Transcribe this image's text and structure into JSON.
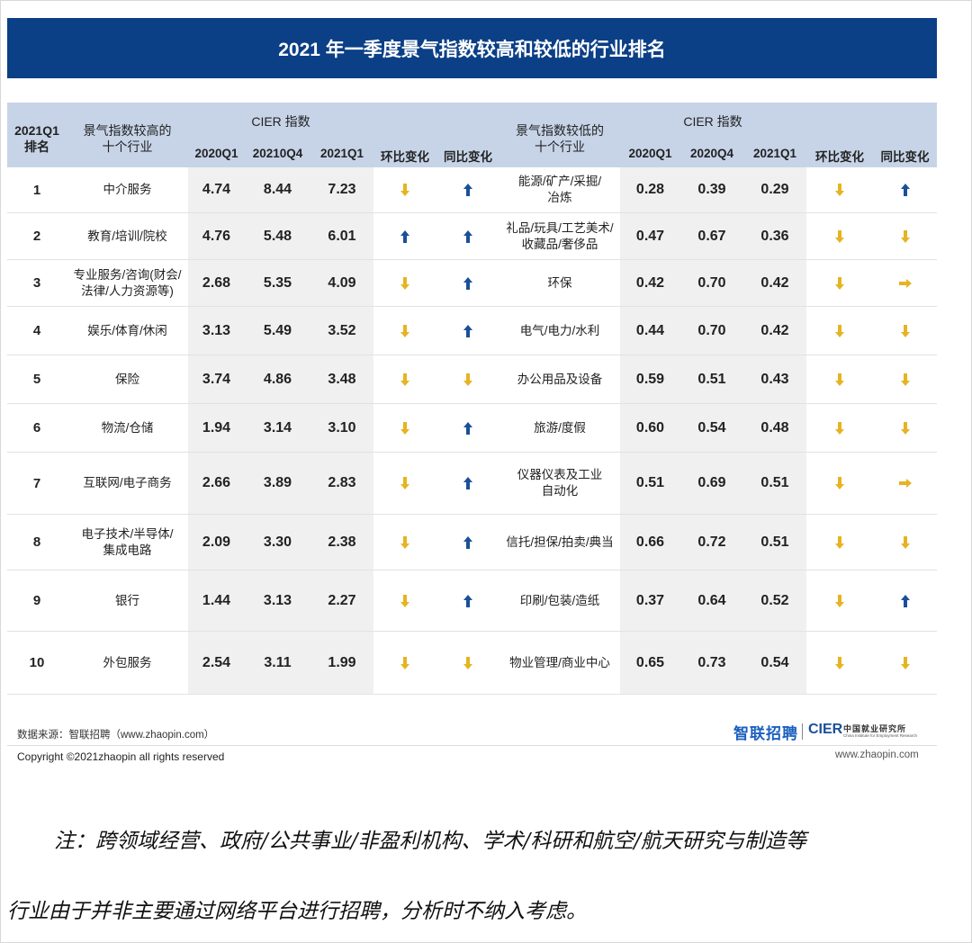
{
  "title": "2021 年一季度景气指数较高和较低的行业排名",
  "header": {
    "rank_l1": "2021Q1",
    "rank_l2": "排名",
    "high_l1": "景气指数较高的",
    "high_l2": "十个行业",
    "cier_left": "CIER 指数",
    "left_cols": [
      "2020Q1",
      "20210Q4",
      "2021Q1",
      "环比变化",
      "同比变化"
    ],
    "low_l1": "景气指数较低的",
    "low_l2": "十个行业",
    "cier_right": "CIER 指数",
    "right_cols": [
      "2020Q1",
      "2020Q4",
      "2021Q1",
      "环比变化",
      "同比变化"
    ]
  },
  "colors": {
    "banner": "#0b3f86",
    "header_bg": "#c7d4e8",
    "arrow_blue": "#1b4f9a",
    "arrow_yellow": "#e6b422"
  },
  "rows": [
    {
      "rank": "1",
      "high_l1": "中介服务",
      "high_l2": "",
      "h1": "4.74",
      "h2": "8.44",
      "h3": "7.23",
      "h_qoq": "down",
      "h_yoy": "up",
      "low_l1": "能源/矿产/采掘/",
      "low_l2": "冶炼",
      "l1": "0.28",
      "l2": "0.39",
      "l3": "0.29",
      "l_qoq": "down",
      "l_yoy": "up"
    },
    {
      "rank": "2",
      "high_l1": "教育/培训/院校",
      "high_l2": "",
      "h1": "4.76",
      "h2": "5.48",
      "h3": "6.01",
      "h_qoq": "up",
      "h_yoy": "up",
      "low_l1": "礼品/玩具/工艺美术/",
      "low_l2": "收藏品/奢侈品",
      "l1": "0.47",
      "l2": "0.67",
      "l3": "0.36",
      "l_qoq": "down",
      "l_yoy": "down"
    },
    {
      "rank": "3",
      "high_l1": "专业服务/咨询(财会/",
      "high_l2": "法律/人力资源等)",
      "h1": "2.68",
      "h2": "5.35",
      "h3": "4.09",
      "h_qoq": "down",
      "h_yoy": "up",
      "low_l1": "环保",
      "low_l2": "",
      "l1": "0.42",
      "l2": "0.70",
      "l3": "0.42",
      "l_qoq": "down",
      "l_yoy": "right"
    },
    {
      "rank": "4",
      "high_l1": "娱乐/体育/休闲",
      "high_l2": "",
      "h1": "3.13",
      "h2": "5.49",
      "h3": "3.52",
      "h_qoq": "down",
      "h_yoy": "up",
      "low_l1": "电气/电力/水利",
      "low_l2": "",
      "l1": "0.44",
      "l2": "0.70",
      "l3": "0.42",
      "l_qoq": "down",
      "l_yoy": "down"
    },
    {
      "rank": "5",
      "high_l1": "保险",
      "high_l2": "",
      "h1": "3.74",
      "h2": "4.86",
      "h3": "3.48",
      "h_qoq": "down",
      "h_yoy": "down",
      "low_l1": "办公用品及设备",
      "low_l2": "",
      "l1": "0.59",
      "l2": "0.51",
      "l3": "0.43",
      "l_qoq": "down",
      "l_yoy": "down"
    },
    {
      "rank": "6",
      "high_l1": "物流/仓储",
      "high_l2": "",
      "h1": "1.94",
      "h2": "3.14",
      "h3": "3.10",
      "h_qoq": "down",
      "h_yoy": "up",
      "low_l1": "旅游/度假",
      "low_l2": "",
      "l1": "0.60",
      "l2": "0.54",
      "l3": "0.48",
      "l_qoq": "down",
      "l_yoy": "down"
    },
    {
      "rank": "7",
      "high_l1": "互联网/电子商务",
      "high_l2": "",
      "h1": "2.66",
      "h2": "3.89",
      "h3": "2.83",
      "h_qoq": "down",
      "h_yoy": "up",
      "low_l1": "仪器仪表及工业",
      "low_l2": "自动化",
      "l1": "0.51",
      "l2": "0.69",
      "l3": "0.51",
      "l_qoq": "down",
      "l_yoy": "right"
    },
    {
      "rank": "8",
      "high_l1": "电子技术/半导体/",
      "high_l2": "集成电路",
      "h1": "2.09",
      "h2": "3.30",
      "h3": "2.38",
      "h_qoq": "down",
      "h_yoy": "up",
      "low_l1": "信托/担保/拍卖/典当",
      "low_l2": "",
      "l1": "0.66",
      "l2": "0.72",
      "l3": "0.51",
      "l_qoq": "down",
      "l_yoy": "down"
    },
    {
      "rank": "9",
      "high_l1": "银行",
      "high_l2": "",
      "h1": "1.44",
      "h2": "3.13",
      "h3": "2.27",
      "h_qoq": "down",
      "h_yoy": "up",
      "low_l1": "印刷/包装/造纸",
      "low_l2": "",
      "l1": "0.37",
      "l2": "0.64",
      "l3": "0.52",
      "l_qoq": "down",
      "l_yoy": "up"
    },
    {
      "rank": "10",
      "high_l1": "外包服务",
      "high_l2": "",
      "h1": "2.54",
      "h2": "3.11",
      "h3": "1.99",
      "h_qoq": "down",
      "h_yoy": "down",
      "low_l1": "物业管理/商业中心",
      "low_l2": "",
      "l1": "0.65",
      "l2": "0.73",
      "l3": "0.54",
      "l_qoq": "down",
      "l_yoy": "down"
    }
  ],
  "footer": {
    "source": "数据来源：智联招聘（www.zhaopin.com）",
    "copyright": "Copyright ©2021zhaopin all rights reserved",
    "logo_zhilian": "智联招聘",
    "logo_cier": "CIER",
    "logo_cier_cn": "中国就业研究所",
    "logo_cier_en": "China Institute for Employment Research",
    "url": "www.zhaopin.com"
  },
  "note": {
    "line1": "注：跨领域经营、政府/公共事业/非盈利机构、学术/科研和航空/航天研究与制造等",
    "line2": "行业由于并非主要通过网络平台进行招聘，分析时不纳入考虑。"
  }
}
